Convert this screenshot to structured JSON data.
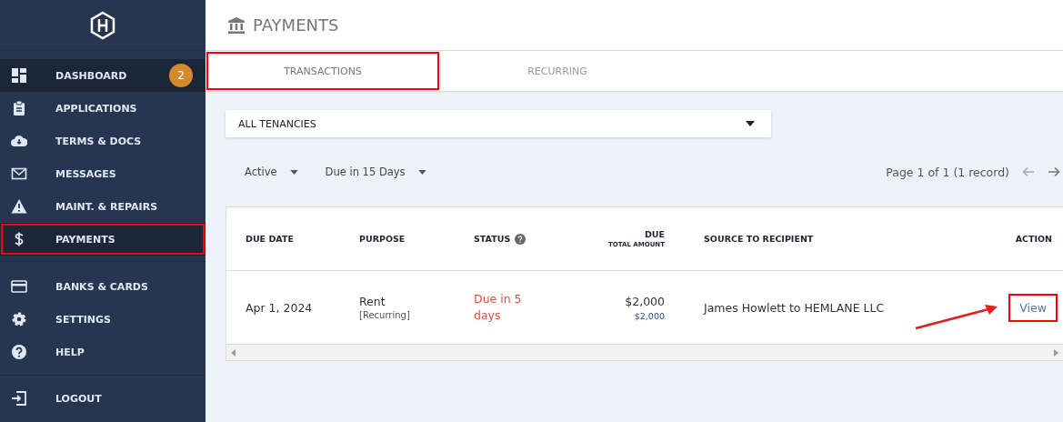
{
  "sidebar": {
    "groups": [
      {
        "items": [
          {
            "label": "DASHBOARD",
            "selected": true,
            "highlighted": false,
            "badge": "2"
          },
          {
            "label": "APPLICATIONS",
            "selected": false,
            "highlighted": false
          },
          {
            "label": "TERMS & DOCS",
            "selected": false,
            "highlighted": false
          },
          {
            "label": "MESSAGES",
            "selected": false,
            "highlighted": false
          },
          {
            "label": "MAINT. & REPAIRS",
            "selected": false,
            "highlighted": false
          },
          {
            "label": "PAYMENTS",
            "selected": true,
            "highlighted": true
          }
        ]
      },
      {
        "items": [
          {
            "label": "BANKS & CARDS",
            "selected": false,
            "highlighted": false
          },
          {
            "label": "SETTINGS",
            "selected": false,
            "highlighted": false
          },
          {
            "label": "HELP",
            "selected": false,
            "highlighted": false
          }
        ]
      },
      {
        "items": [
          {
            "label": "LOGOUT",
            "selected": false,
            "highlighted": false
          }
        ]
      }
    ]
  },
  "page": {
    "title": "PAYMENTS"
  },
  "tabs": [
    {
      "label": "TRANSACTIONS",
      "selected": true,
      "highlighted": true
    },
    {
      "label": "RECURRING",
      "selected": false,
      "highlighted": false
    }
  ],
  "tenancy_select": {
    "value": "ALL TENANCIES"
  },
  "filters": [
    {
      "value": "Active"
    },
    {
      "value": "Due in 15 Days"
    }
  ],
  "pagination": {
    "text": "Page 1 of 1 (1 record)",
    "prev_disabled": true,
    "next_disabled": false
  },
  "table": {
    "columns": [
      {
        "label": "DUE DATE",
        "help": false
      },
      {
        "label": "PURPOSE",
        "help": false
      },
      {
        "label": "STATUS",
        "help": true
      },
      {
        "label": "DUE",
        "sublabel": "TOTAL AMOUNT",
        "help": false
      },
      {
        "label": "SOURCE  TO  RECIPIENT",
        "help": false
      },
      {
        "label": "ACTION",
        "help": false
      }
    ],
    "rows": [
      {
        "due_date": "Apr 1, 2024",
        "purpose": "Rent",
        "purpose_note": "[Recurring]",
        "status": "Due in 5 days",
        "due": "$2,000",
        "total": "$2,000",
        "source_to_recipient": "James Howlett  to  HEMLANE LLC",
        "action": "View",
        "action_highlighted": true
      }
    ]
  }
}
